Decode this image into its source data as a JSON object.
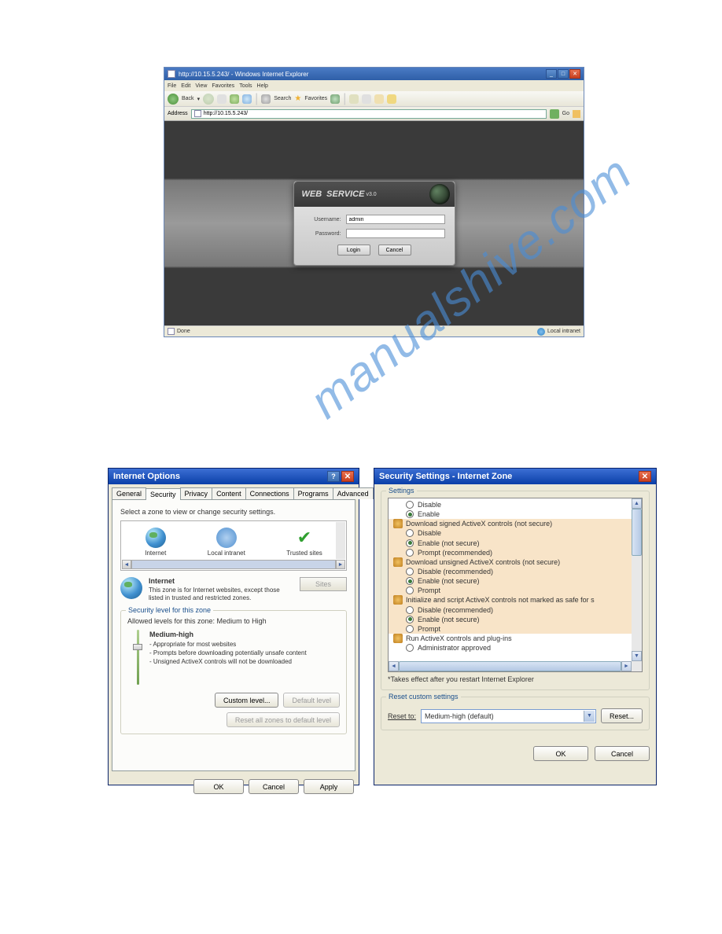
{
  "browser": {
    "title": "http://10.15.5.243/ - Windows Internet Explorer",
    "menu": [
      "File",
      "Edit",
      "View",
      "Favorites",
      "Tools",
      "Help"
    ],
    "toolbar": {
      "back": "Back",
      "search": "Search",
      "favorites": "Favorites"
    },
    "address_label": "Address",
    "address_value": "http://10.15.5.243/",
    "go_label": "Go",
    "status_left": "Done",
    "status_right": "Local intranet",
    "login": {
      "brand_a": "WEB",
      "brand_b": "SERVICE",
      "version": "v3.0",
      "username_label": "Username:",
      "username_value": "admin",
      "password_label": "Password:",
      "password_value": "",
      "login_btn": "Login",
      "cancel_btn": "Cancel"
    }
  },
  "watermark": "manualshive.com",
  "io": {
    "title": "Internet Options",
    "tabs": [
      "General",
      "Security",
      "Privacy",
      "Content",
      "Connections",
      "Programs",
      "Advanced"
    ],
    "active_tab": "Security",
    "instr": "Select a zone to view or change security settings.",
    "zones": {
      "internet": "Internet",
      "intranet": "Local intranet",
      "trusted": "Trusted sites"
    },
    "zone_title": "Internet",
    "zone_desc": "This zone is for Internet websites, except those listed in trusted and restricted zones.",
    "sites_btn": "Sites",
    "sec_legend": "Security level for this zone",
    "sec_allowed": "Allowed levels for this zone: Medium to High",
    "sec_name": "Medium-high",
    "sec_b1": "- Appropriate for most websites",
    "sec_b2": "- Prompts before downloading potentially unsafe content",
    "sec_b3": "- Unsigned ActiveX controls will not be downloaded",
    "custom_btn": "Custom level...",
    "default_btn": "Default level",
    "reset_all_btn": "Reset all zones to default level",
    "ok": "OK",
    "cancel": "Cancel",
    "apply": "Apply"
  },
  "ss": {
    "title": "Security Settings - Internet Zone",
    "settings_legend": "Settings",
    "tree": {
      "opt_disable": "Disable",
      "opt_enable": "Enable",
      "opt_enable_ns": "Enable (not secure)",
      "opt_prompt": "Prompt",
      "opt_prompt_rec": "Prompt (recommended)",
      "opt_disable_rec": "Disable (recommended)",
      "opt_admin": "Administrator approved",
      "cat_dl_signed": "Download signed ActiveX controls (not secure)",
      "cat_dl_unsigned": "Download unsigned ActiveX controls (not secure)",
      "cat_init_script": "Initialize and script ActiveX controls not marked as safe for s",
      "cat_run": "Run ActiveX controls and plug-ins"
    },
    "note": "*Takes effect after you restart Internet Explorer",
    "reset_legend": "Reset custom settings",
    "reset_to_label": "Reset to:",
    "reset_to_value": "Medium-high (default)",
    "reset_btn": "Reset...",
    "ok": "OK",
    "cancel": "Cancel"
  }
}
